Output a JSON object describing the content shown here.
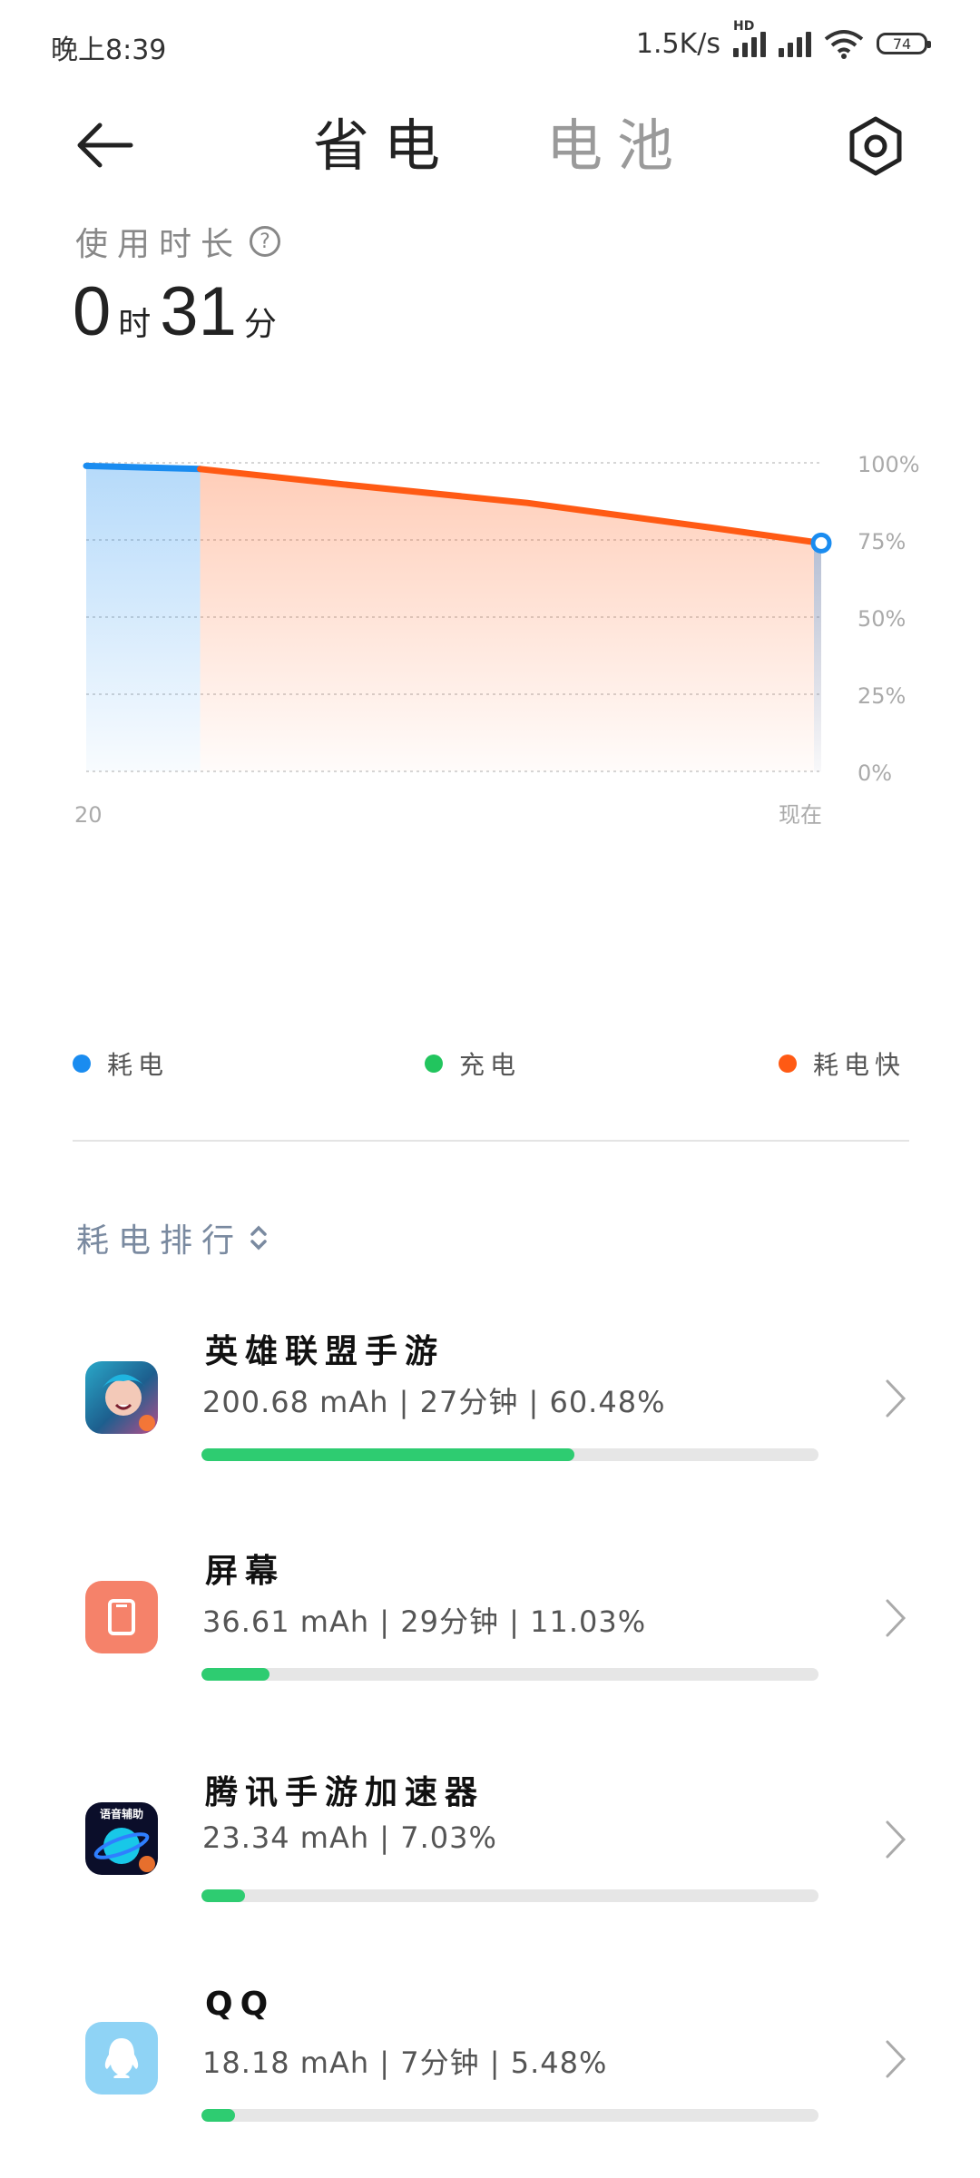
{
  "status_bar": {
    "time": "晚上8:39",
    "net_speed": "1.5K/s",
    "hd_label": "HD",
    "battery_level": "74"
  },
  "header": {
    "tabs": [
      {
        "label": "省电",
        "active": true
      },
      {
        "label": "电池",
        "active": false
      }
    ]
  },
  "usage": {
    "label": "使用时长",
    "hours": "0",
    "hours_unit": "时",
    "minutes": "31",
    "minutes_unit": "分"
  },
  "chart_data": {
    "type": "area",
    "y_ticks": [
      "100%",
      "75%",
      "50%",
      "25%",
      "0%"
    ],
    "ylim": [
      0,
      100
    ],
    "x_labels": [
      "20",
      "现在"
    ],
    "series": [
      {
        "name": "耗电",
        "color": "#1a8cf0",
        "points": [
          [
            0,
            99
          ],
          [
            0.155,
            98
          ]
        ]
      },
      {
        "name": "耗电快",
        "color": "#ff5a14",
        "points": [
          [
            0.155,
            98
          ],
          [
            0.35,
            93
          ],
          [
            0.6,
            87
          ],
          [
            0.85,
            79
          ],
          [
            1.0,
            74
          ]
        ]
      }
    ],
    "end_marker_value": 74,
    "grid": true,
    "legend": [
      {
        "label": "耗电",
        "color": "#1a8cf0"
      },
      {
        "label": "充电",
        "color": "#22c55e"
      },
      {
        "label": "耗电快",
        "color": "#ff5a14"
      }
    ]
  },
  "ranking": {
    "title": "耗电排行",
    "items": [
      {
        "name": "英雄联盟手游",
        "stats": "200.68 mAh | 27分钟 | 60.48%",
        "percent": 60.48,
        "icon": "lol-game-icon"
      },
      {
        "name": "屏幕",
        "stats": "36.61 mAh | 29分钟 | 11.03%",
        "percent": 11.03,
        "icon": "screen-icon"
      },
      {
        "name": "腾讯手游加速器",
        "stats": "23.34 mAh | 7.03%",
        "percent": 7.03,
        "icon": "accelerator-icon",
        "icon_text": "语音辅助"
      },
      {
        "name": "QQ",
        "stats": "18.18 mAh | 7分钟 | 5.48%",
        "percent": 5.48,
        "icon": "qq-icon"
      }
    ]
  }
}
